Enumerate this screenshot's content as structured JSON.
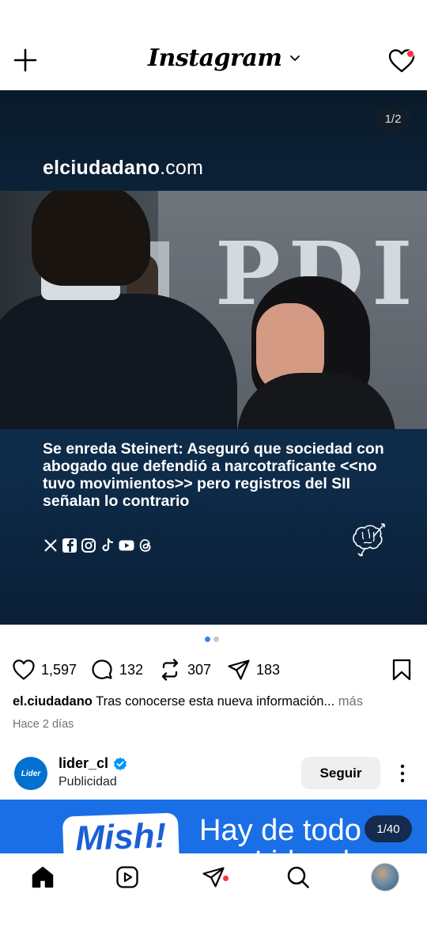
{
  "header": {
    "app_title": "Instagram",
    "icons": {
      "new_post": "plus-icon",
      "switch_feed": "chevron-down-icon",
      "activity": "heart-icon"
    },
    "notif_color": "#ff3040"
  },
  "post": {
    "media_counter": "1/2",
    "image": {
      "site_name": "elciudadano",
      "site_suffix": ".com",
      "photo_sign_text": "PDI",
      "headline": "Se enreda Steinert: Aseguró que sociedad con abogado que defendió a narcotraficante <<no tuvo movimientos>> pero registros del SII señalan lo contrario",
      "social_icons": [
        "x-icon",
        "facebook-icon",
        "instagram-icon",
        "tiktok-icon",
        "youtube-icon",
        "threads-icon"
      ],
      "brand_icon": "brain-icon"
    },
    "pager": {
      "count": 2,
      "active": 1,
      "active_color": "#3b82f6"
    },
    "likes": "1,597",
    "comments": "132",
    "reposts": "307",
    "shares": "183",
    "caption": {
      "username": "el.ciudadano",
      "text": " Tras conocerse esta nueva información...",
      "more": " más"
    },
    "time_ago": "Hace 2 días"
  },
  "ad": {
    "avatar_text": "Lider",
    "username": "lider_cl",
    "verified_color": "#0095f6",
    "label": "Publicidad",
    "follow_button": "Seguir",
    "banner": {
      "logo_text": "Mish!",
      "slogan_line1": "Hay de todo",
      "slogan_line2": "a Lider.cl",
      "counter": "1/40",
      "bg_color": "#1a6fe6"
    }
  },
  "bottom_nav": {
    "items": [
      "home-icon",
      "reels-icon",
      "direct-icon",
      "search-icon",
      "profile-avatar"
    ]
  }
}
